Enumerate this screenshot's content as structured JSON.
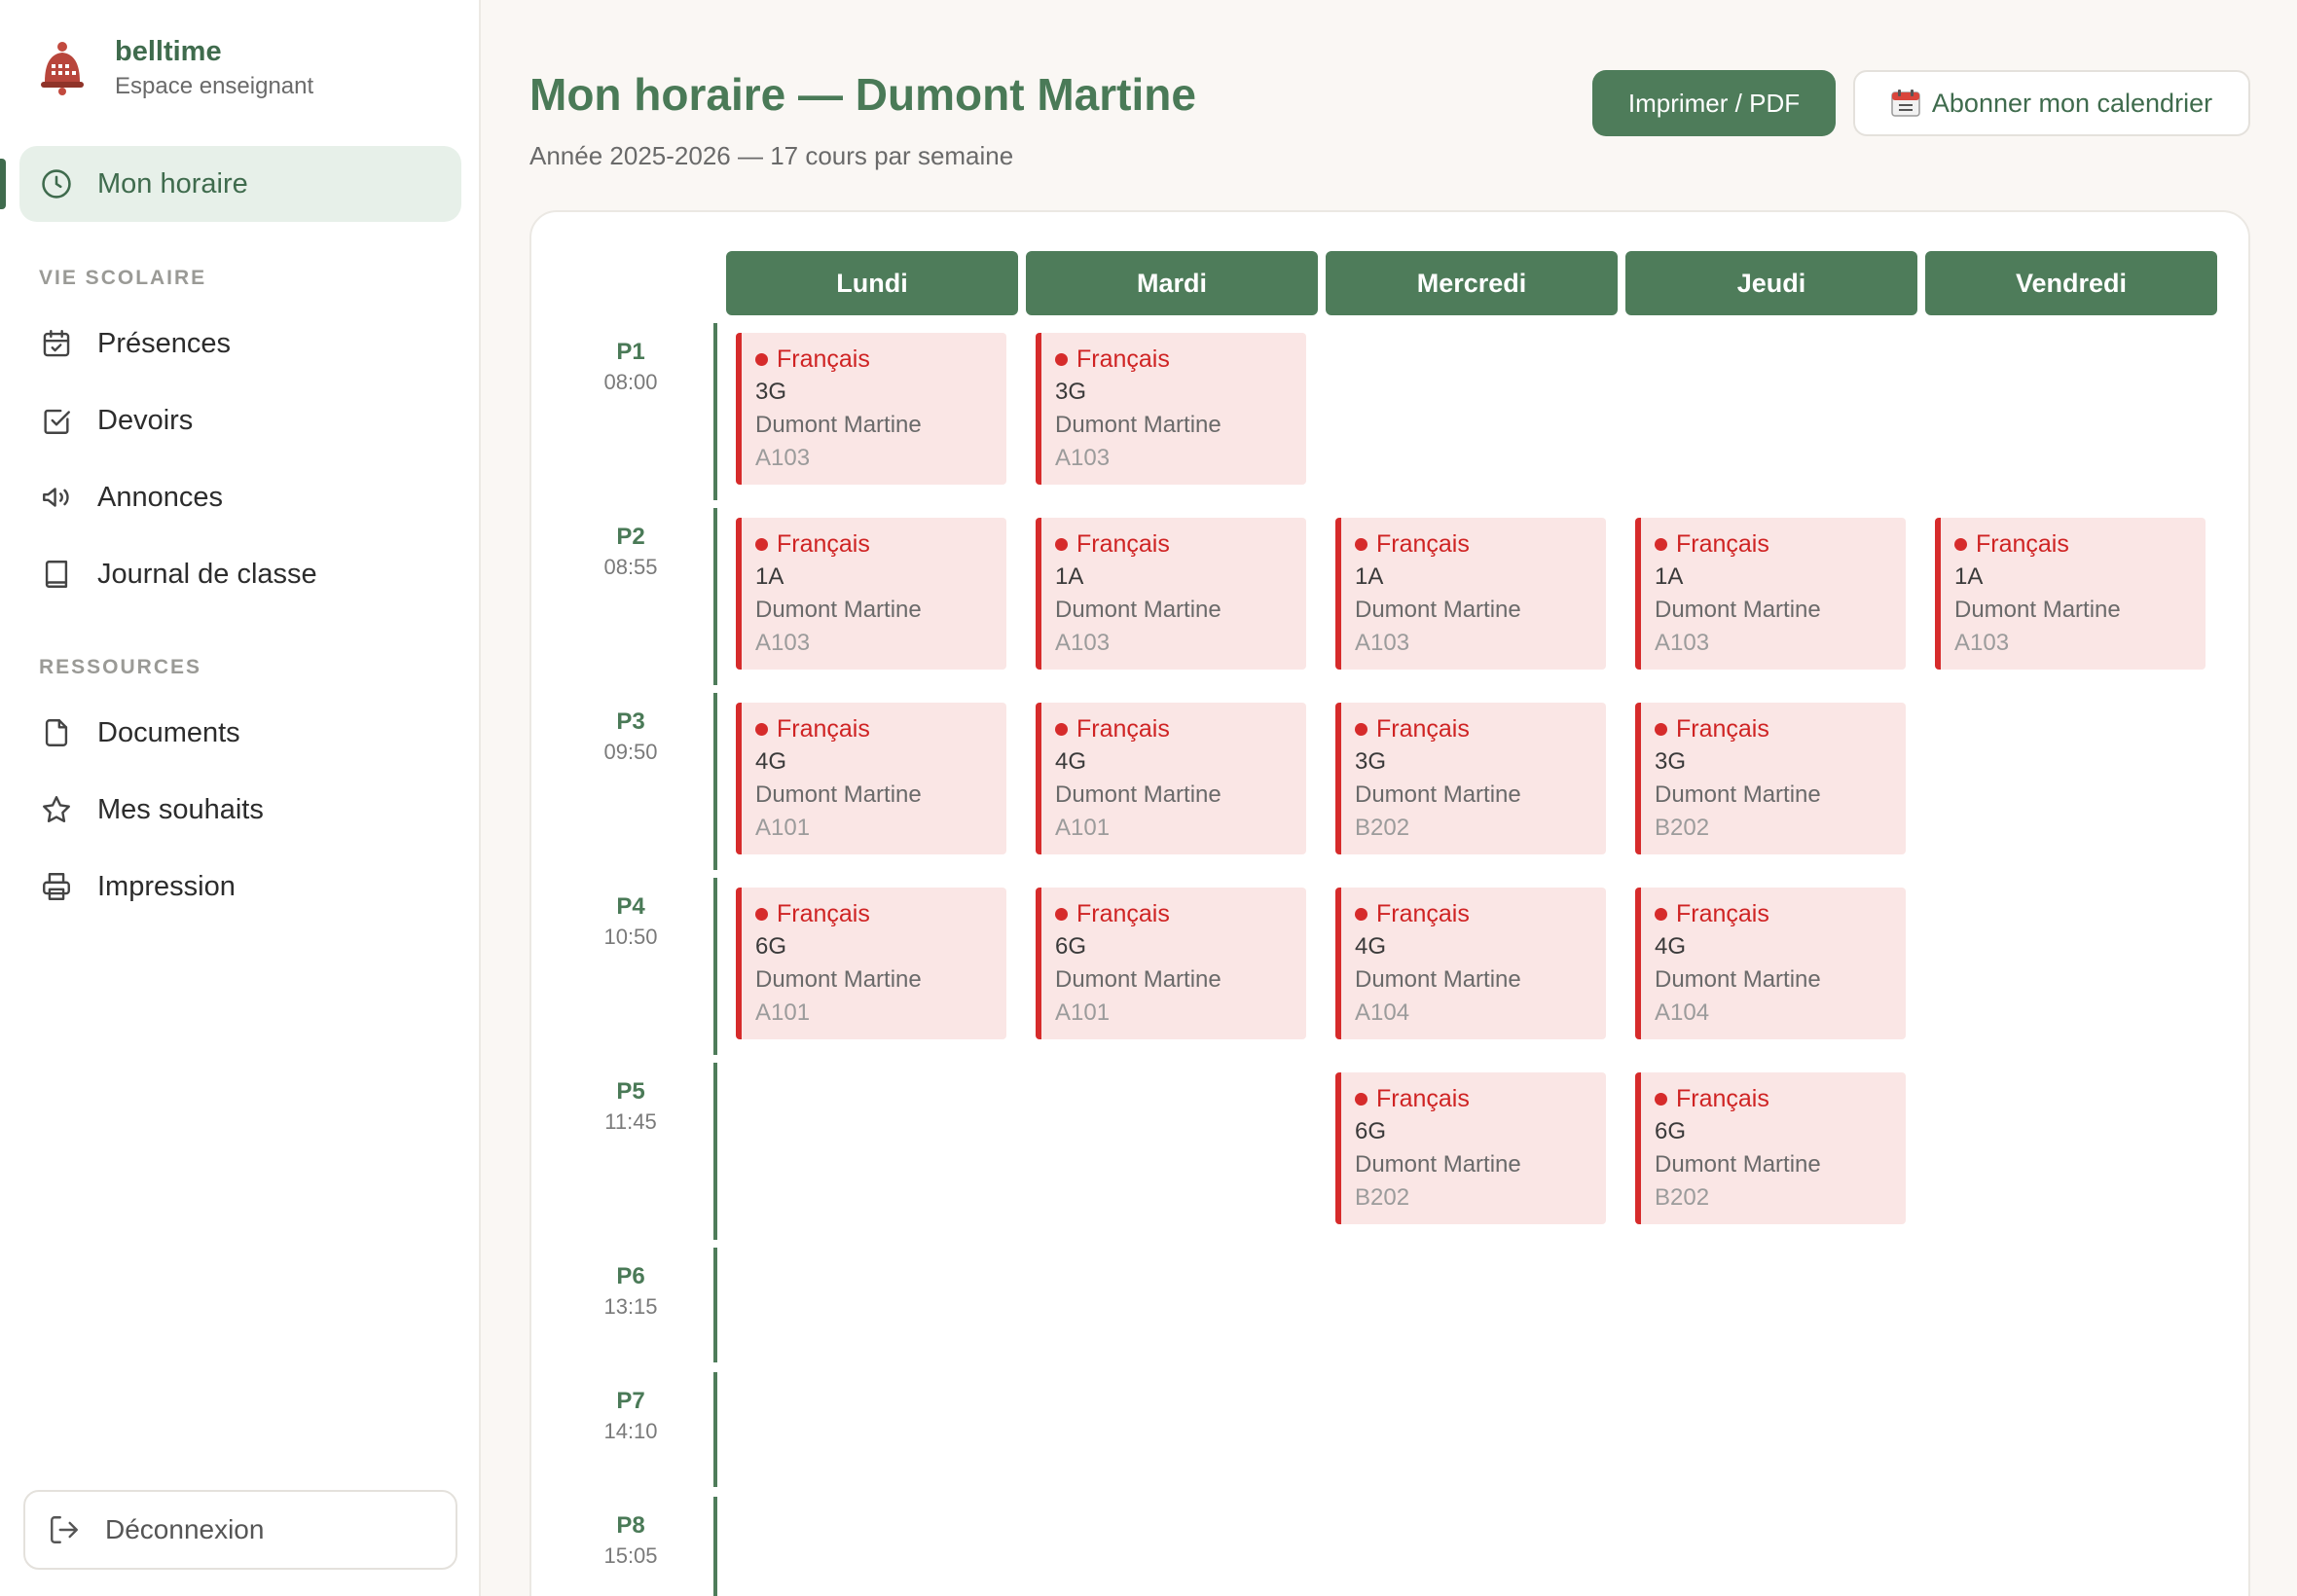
{
  "brand": {
    "name": "belltime",
    "subtitle": "Espace enseignant"
  },
  "sidebar": {
    "active_item": {
      "label": "Mon horaire",
      "icon": "clock-icon"
    },
    "sections": [
      {
        "title": "VIE SCOLAIRE",
        "items": [
          {
            "label": "Présences",
            "icon": "calendar-check-icon"
          },
          {
            "label": "Devoirs",
            "icon": "checkbox-icon"
          },
          {
            "label": "Annonces",
            "icon": "megaphone-icon"
          },
          {
            "label": "Journal de classe",
            "icon": "book-icon"
          }
        ]
      },
      {
        "title": "RESSOURCES",
        "items": [
          {
            "label": "Documents",
            "icon": "file-icon"
          },
          {
            "label": "Mes souhaits",
            "icon": "star-icon"
          },
          {
            "label": "Impression",
            "icon": "printer-icon"
          }
        ]
      }
    ],
    "logout_label": "Déconnexion"
  },
  "header": {
    "title": "Mon horaire — Dumont Martine",
    "subtitle": "Année 2025-2026 — 17 cours par semaine",
    "print_label": "Imprimer / PDF",
    "subscribe_label": "Abonner mon calendrier"
  },
  "schedule": {
    "days": [
      "Lundi",
      "Mardi",
      "Mercredi",
      "Jeudi",
      "Vendredi"
    ],
    "periods": [
      {
        "label": "P1",
        "time": "08:00"
      },
      {
        "label": "P2",
        "time": "08:55"
      },
      {
        "label": "P3",
        "time": "09:50"
      },
      {
        "label": "P4",
        "time": "10:50"
      },
      {
        "label": "P5",
        "time": "11:45"
      },
      {
        "label": "P6",
        "time": "13:15"
      },
      {
        "label": "P7",
        "time": "14:10"
      },
      {
        "label": "P8",
        "time": "15:05"
      }
    ],
    "lessons": [
      {
        "day": 0,
        "period": 0,
        "subject": "Français",
        "class": "3G",
        "teacher": "Dumont Martine",
        "room": "A103"
      },
      {
        "day": 1,
        "period": 0,
        "subject": "Français",
        "class": "3G",
        "teacher": "Dumont Martine",
        "room": "A103"
      },
      {
        "day": 0,
        "period": 1,
        "subject": "Français",
        "class": "1A",
        "teacher": "Dumont Martine",
        "room": "A103"
      },
      {
        "day": 1,
        "period": 1,
        "subject": "Français",
        "class": "1A",
        "teacher": "Dumont Martine",
        "room": "A103"
      },
      {
        "day": 2,
        "period": 1,
        "subject": "Français",
        "class": "1A",
        "teacher": "Dumont Martine",
        "room": "A103"
      },
      {
        "day": 3,
        "period": 1,
        "subject": "Français",
        "class": "1A",
        "teacher": "Dumont Martine",
        "room": "A103"
      },
      {
        "day": 4,
        "period": 1,
        "subject": "Français",
        "class": "1A",
        "teacher": "Dumont Martine",
        "room": "A103"
      },
      {
        "day": 0,
        "period": 2,
        "subject": "Français",
        "class": "4G",
        "teacher": "Dumont Martine",
        "room": "A101"
      },
      {
        "day": 1,
        "period": 2,
        "subject": "Français",
        "class": "4G",
        "teacher": "Dumont Martine",
        "room": "A101"
      },
      {
        "day": 2,
        "period": 2,
        "subject": "Français",
        "class": "3G",
        "teacher": "Dumont Martine",
        "room": "B202"
      },
      {
        "day": 3,
        "period": 2,
        "subject": "Français",
        "class": "3G",
        "teacher": "Dumont Martine",
        "room": "B202"
      },
      {
        "day": 0,
        "period": 3,
        "subject": "Français",
        "class": "6G",
        "teacher": "Dumont Martine",
        "room": "A101"
      },
      {
        "day": 1,
        "period": 3,
        "subject": "Français",
        "class": "6G",
        "teacher": "Dumont Martine",
        "room": "A101"
      },
      {
        "day": 2,
        "period": 3,
        "subject": "Français",
        "class": "4G",
        "teacher": "Dumont Martine",
        "room": "A104"
      },
      {
        "day": 3,
        "period": 3,
        "subject": "Français",
        "class": "4G",
        "teacher": "Dumont Martine",
        "room": "A104"
      },
      {
        "day": 2,
        "period": 4,
        "subject": "Français",
        "class": "6G",
        "teacher": "Dumont Martine",
        "room": "B202"
      },
      {
        "day": 3,
        "period": 4,
        "subject": "Français",
        "class": "6G",
        "teacher": "Dumont Martine",
        "room": "B202"
      }
    ]
  },
  "colors": {
    "primary": "#4e7c5a",
    "lesson_bg": "#fae6e5",
    "lesson_accent": "#d62b2b",
    "page_bg": "#faf7f4"
  }
}
